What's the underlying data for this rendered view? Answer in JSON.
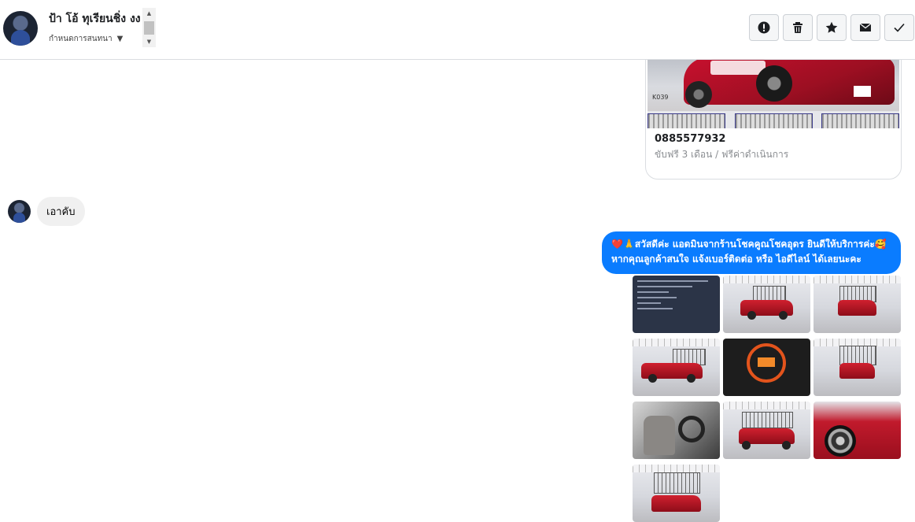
{
  "header": {
    "contact_name": "ป้า โอ้ ทุเรียนชิ่ง งง",
    "label_select": "กำหนดการสนทนา",
    "actions": [
      {
        "name": "report",
        "icon": "exclamation-icon"
      },
      {
        "name": "delete",
        "icon": "trash-icon"
      },
      {
        "name": "star",
        "icon": "star-icon"
      },
      {
        "name": "mark-unread",
        "icon": "envelope-icon"
      },
      {
        "name": "done",
        "icon": "check-icon"
      }
    ]
  },
  "card": {
    "image_tag": "K039",
    "phone": "0885577932",
    "subtitle": "ขับฟรี 3 เดือน / ฟรีค่าดำเนินการ"
  },
  "incoming": {
    "text": "เอาคับ"
  },
  "outgoing": {
    "line1": "สวัสดีค่ะ แอดมินจากร้านโชคคูณโชคอุดร ยินดีให้บริการค่ะ",
    "line2": "หากคุณลูกค้าสนใจ แจ้งเบอร์ติดต่อ หรือ ไอดีไลน์ ได้เลยนะคะ",
    "emoji_start": "❤️🙏",
    "emoji_end": "🥰"
  },
  "gallery": [
    {
      "kind": "document"
    },
    {
      "kind": "truck-side"
    },
    {
      "kind": "truck-rear"
    },
    {
      "kind": "truck-side"
    },
    {
      "kind": "dashboard"
    },
    {
      "kind": "truck-rear"
    },
    {
      "kind": "interior"
    },
    {
      "kind": "truck-front"
    },
    {
      "kind": "wheel-closeup"
    },
    {
      "kind": "truck-front"
    }
  ],
  "colors": {
    "outgoing_bubble": "#0a7cff",
    "incoming_bubble": "#f0f0f0"
  }
}
